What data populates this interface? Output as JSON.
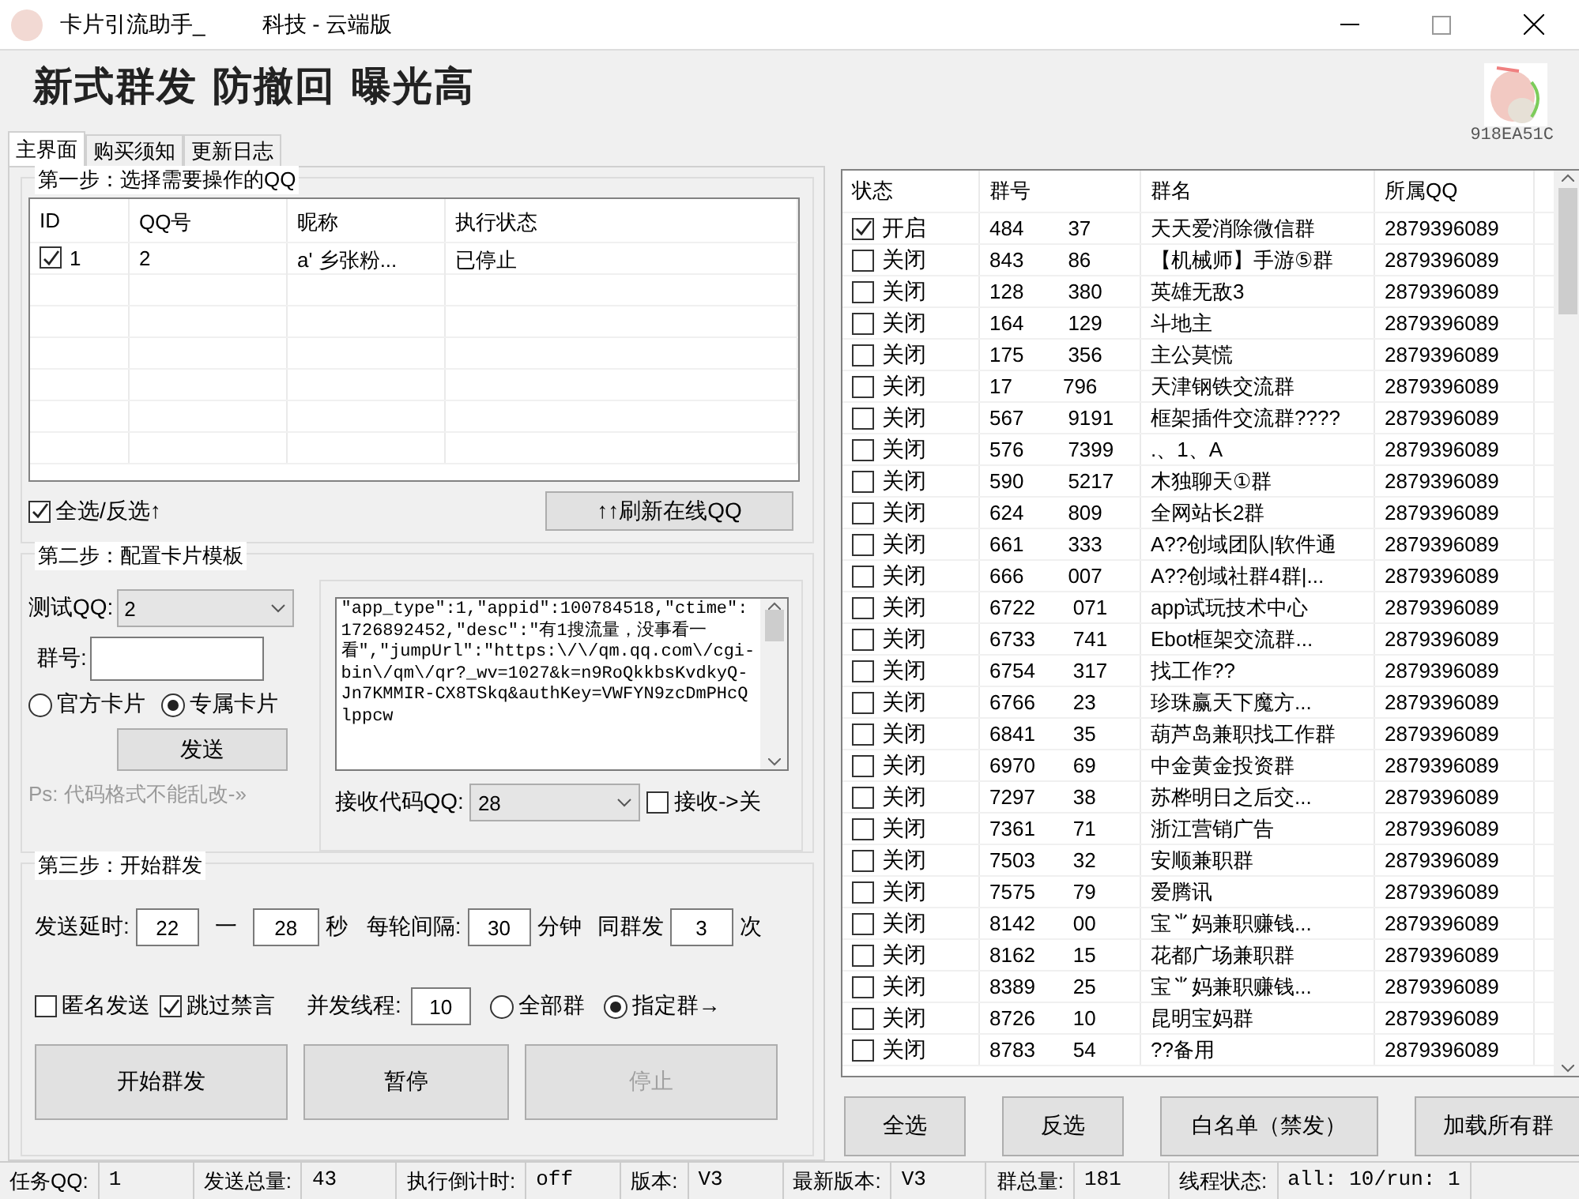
{
  "window": {
    "title_start": "卡片引流助手_",
    "title_end": "科技 - 云端版"
  },
  "headline": "新式群发 防撤回 曝光高",
  "machine_code": "918EA51C",
  "tabs": [
    {
      "label": "主界面",
      "selected": true
    },
    {
      "label": "购买须知",
      "selected": false
    },
    {
      "label": "更新日志",
      "selected": false
    }
  ],
  "step1": {
    "title": "第一步：选择需要操作的QQ",
    "columns": [
      "ID",
      "QQ号",
      "昵称",
      "执行状态"
    ],
    "rows": [
      {
        "checked": true,
        "id": "1",
        "qq": "2",
        "nickname": "a' 乡张粉...",
        "status": "已停止"
      }
    ],
    "select_all": {
      "label": "全选/反选↑",
      "checked": true
    },
    "refresh_button": "↑↑刷新在线QQ"
  },
  "step2": {
    "title": "第二步：配置卡片模板",
    "test_qq_label": "测试QQ:",
    "test_qq": "2",
    "group_label": "群号:",
    "card_types": [
      {
        "label": "官方卡片",
        "selected": false
      },
      {
        "label": "专属卡片",
        "selected": true
      }
    ],
    "send_button": "发送",
    "note": "Ps: 代码格式不能乱改-»",
    "code": "\"app_type\":1,\"appid\":100784518,\"ctime\":1726892452,\"desc\":\"有1搜流量，没事看一看\",\"jumpUrl\":\"https:\\/\\/qm.qq.com\\/cgi-bin\\/qm\\/qr?_wv=1027&k=n9RoQkkbsKvdkyQ-Jn7KMMIR-CX8TSkq&authKey=VWFYN9zcDmPHcQlppcw",
    "receive_label": "接收代码QQ:",
    "receive_qq": "28",
    "receive_toggle": {
      "label": "接收->关",
      "checked": false
    }
  },
  "step3": {
    "title": "第三步：开始群发",
    "delay_label": "发送延时:",
    "delay_min": "22",
    "dash": "一",
    "delay_max": "28",
    "seconds": "秒",
    "interval_label": "每轮间隔:",
    "interval": "30",
    "minutes": "分钟",
    "repeat_label": "同群发",
    "repeat": "3",
    "times": "次",
    "options": [
      {
        "label": "匿名发送",
        "checked": false
      },
      {
        "label": "跳过禁言",
        "checked": true
      }
    ],
    "threads_label": "并发线程:",
    "threads": "10",
    "targets": [
      {
        "label": "全部群",
        "selected": false
      },
      {
        "label": "指定群→",
        "selected": true
      }
    ],
    "buttons": [
      {
        "label": "开始群发",
        "disabled": false
      },
      {
        "label": "暂停",
        "disabled": false
      },
      {
        "label": "停止",
        "disabled": true
      }
    ]
  },
  "groups": {
    "columns": [
      "状态",
      "群号",
      "群名",
      "所属QQ"
    ],
    "rows": [
      {
        "checked": true,
        "status": "开启",
        "number_start": "484",
        "number_end": "37",
        "name": "天天爱消除微信群",
        "owner": "2879396089"
      },
      {
        "checked": false,
        "status": "关闭",
        "number_start": "843",
        "number_end": "86",
        "name": "【机械师】手游⑤群",
        "owner": "2879396089"
      },
      {
        "checked": false,
        "status": "关闭",
        "number_start": "128",
        "number_end": "380",
        "name": "英雄无敌3",
        "owner": "2879396089"
      },
      {
        "checked": false,
        "status": "关闭",
        "number_start": "164",
        "number_end": "129",
        "name": "斗地主",
        "owner": "2879396089"
      },
      {
        "checked": false,
        "status": "关闭",
        "number_start": "175",
        "number_end": "356",
        "name": "主公莫慌",
        "owner": "2879396089"
      },
      {
        "checked": false,
        "status": "关闭",
        "number_start": "17",
        "number_end": "796",
        "name": "天津钢铁交流群",
        "owner": "2879396089"
      },
      {
        "checked": false,
        "status": "关闭",
        "number_start": "567",
        "number_end": "9191",
        "name": "框架插件交流群????",
        "owner": "2879396089"
      },
      {
        "checked": false,
        "status": "关闭",
        "number_start": "576",
        "number_end": "7399",
        "name": ".、1、A",
        "owner": "2879396089"
      },
      {
        "checked": false,
        "status": "关闭",
        "number_start": "590",
        "number_end": "5217",
        "name": "木独聊天①群",
        "owner": "2879396089"
      },
      {
        "checked": false,
        "status": "关闭",
        "number_start": "624",
        "number_end": "809",
        "name": "全网站长2群",
        "owner": "2879396089"
      },
      {
        "checked": false,
        "status": "关闭",
        "number_start": "661",
        "number_end": "333",
        "name": "A??创域团队|软件通",
        "owner": "2879396089"
      },
      {
        "checked": false,
        "status": "关闭",
        "number_start": "666",
        "number_end": "007",
        "name": "A??创域社群4群|...",
        "owner": "2879396089"
      },
      {
        "checked": false,
        "status": "关闭",
        "number_start": "6722",
        "number_end": "071",
        "name": "app试玩技术中心",
        "owner": "2879396089"
      },
      {
        "checked": false,
        "status": "关闭",
        "number_start": "6733",
        "number_end": "741",
        "name": "Ebot框架交流群...",
        "owner": "2879396089"
      },
      {
        "checked": false,
        "status": "关闭",
        "number_start": "6754",
        "number_end": "317",
        "name": "找工作??",
        "owner": "2879396089"
      },
      {
        "checked": false,
        "status": "关闭",
        "number_start": "6766",
        "number_end": "23",
        "name": "珍珠赢天下魔方...",
        "owner": "2879396089"
      },
      {
        "checked": false,
        "status": "关闭",
        "number_start": "6841",
        "number_end": "35",
        "name": "葫芦岛兼职找工作群",
        "owner": "2879396089"
      },
      {
        "checked": false,
        "status": "关闭",
        "number_start": "6970",
        "number_end": "69",
        "name": "中金黄金投资群",
        "owner": "2879396089"
      },
      {
        "checked": false,
        "status": "关闭",
        "number_start": "7297",
        "number_end": "38",
        "name": "苏桦明日之后交...",
        "owner": "2879396089"
      },
      {
        "checked": false,
        "status": "关闭",
        "number_start": "7361",
        "number_end": "71",
        "name": "浙江营销广告",
        "owner": "2879396089"
      },
      {
        "checked": false,
        "status": "关闭",
        "number_start": "7503",
        "number_end": "32",
        "name": "安顺兼职群",
        "owner": "2879396089"
      },
      {
        "checked": false,
        "status": "关闭",
        "number_start": "7575",
        "number_end": "79",
        "name": "爱腾讯",
        "owner": "2879396089"
      },
      {
        "checked": false,
        "status": "关闭",
        "number_start": "8142",
        "number_end": "00",
        "name": "宝⺌妈兼职赚钱...",
        "owner": "2879396089"
      },
      {
        "checked": false,
        "status": "关闭",
        "number_start": "8162",
        "number_end": "15",
        "name": "花都广场兼职群",
        "owner": "2879396089"
      },
      {
        "checked": false,
        "status": "关闭",
        "number_start": "8389",
        "number_end": "25",
        "name": "宝⺌妈兼职赚钱...",
        "owner": "2879396089"
      },
      {
        "checked": false,
        "status": "关闭",
        "number_start": "8726",
        "number_end": "10",
        "name": "昆明宝妈群",
        "owner": "2879396089"
      },
      {
        "checked": false,
        "status": "关闭",
        "number_start": "8783",
        "number_end": "54",
        "name": "??备用",
        "owner": "2879396089"
      }
    ]
  },
  "group_buttons": [
    "全选",
    "反选",
    "白名单（禁发）",
    "加载所有群"
  ],
  "status_bar": [
    {
      "label": "任务QQ:",
      "value": "1"
    },
    {
      "label": "发送总量:",
      "value": "43"
    },
    {
      "label": "执行倒计时:",
      "value": "off"
    },
    {
      "label": "版本:",
      "value": "V3"
    },
    {
      "label": "最新版本:",
      "value": "V3"
    },
    {
      "label": "群总量:",
      "value": "181"
    },
    {
      "label": "线程状态:",
      "value": "all: 10/run: 1"
    }
  ]
}
